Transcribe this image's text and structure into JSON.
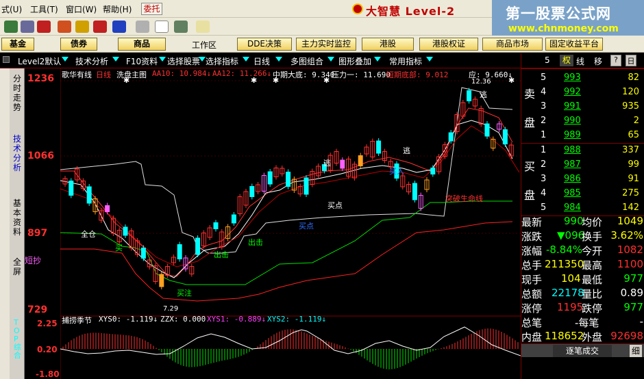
{
  "menu": {
    "items": [
      "式(U)",
      "工具(T)",
      "窗口(W)",
      "帮助(H)"
    ],
    "weituo": "委托",
    "brand": "大智慧 Level-2"
  },
  "watermark": {
    "line1": "第一股票公式网",
    "line2": "www.chnmoney.com"
  },
  "funcbar": {
    "buttons": [
      "基金",
      "债券",
      "商品"
    ],
    "workspace_label": "工作区",
    "modules": [
      "DDE决策",
      "主力实时监控",
      "港股",
      "港股权证",
      "商品市场",
      "固定收益平台"
    ]
  },
  "tabs": {
    "items": [
      "Level2默认",
      "技术分析",
      "F10资料",
      "选择股票",
      "选择指标",
      "日线",
      "多图组合",
      "图形叠加",
      "常用指标"
    ]
  },
  "lefttabs": [
    {
      "label": "分时走势"
    },
    {
      "label": "技术分析"
    },
    {
      "label": "基本资料"
    },
    {
      "label": "全屏"
    }
  ],
  "right_header": {
    "stock_code": "5",
    "buttons": [
      "权",
      "线",
      "移",
      "?",
      "日"
    ]
  },
  "colors": {
    "up": "#ff3030",
    "down": "#00ffff",
    "accent": "#ffff00"
  },
  "main_chart": {
    "header_name": "歌华有线",
    "header_period": "日线",
    "header_formula": "洗盘主图",
    "header_aa10": "AA10: 10.984↓",
    "header_aa12": "AA12: 11.266↓",
    "header_mid": "中期大底: 9.340",
    "header_resist": "压力一: 11.690",
    "header_bottom": "短期底部: 9.012",
    "header_ying": "应: 9.660↓",
    "y_labels": [
      "1236",
      "1066",
      "897",
      "729"
    ],
    "high_label": "12.36",
    "low_label": "7.29",
    "annotations": [
      "全仓",
      "买",
      "买注",
      "出击",
      "出击",
      "买点",
      "买点",
      "逃",
      "逃",
      "逃",
      "买入",
      "突破生命线",
      "短抄"
    ]
  },
  "sub_chart": {
    "header_name": "捕捞季节",
    "header_xys0": "XYS0: -1.119↓",
    "header_zzx": "ZZX: 0.000",
    "header_xys1": "XYS1: -0.889↓",
    "header_xys2": "XYS2: -1.119↓",
    "y_labels": [
      "2.25",
      "0.20",
      "-1.80"
    ],
    "side_label": "TOP综合"
  },
  "orderbook": {
    "sell_label": [
      "卖",
      "盘"
    ],
    "buy_label": [
      "买",
      "盘"
    ],
    "asks": [
      {
        "level": "5",
        "price": "993",
        "volume": "82"
      },
      {
        "level": "4",
        "price": "992",
        "volume": "120"
      },
      {
        "level": "3",
        "price": "991",
        "volume": "935"
      },
      {
        "level": "2",
        "price": "990",
        "volume": "2"
      },
      {
        "level": "1",
        "price": "989",
        "volume": "65"
      }
    ],
    "bids": [
      {
        "level": "1",
        "price": "988",
        "volume": "337"
      },
      {
        "level": "2",
        "price": "987",
        "volume": "99"
      },
      {
        "level": "3",
        "price": "986",
        "volume": "91"
      },
      {
        "level": "4",
        "price": "985",
        "volume": "275"
      },
      {
        "level": "5",
        "price": "984",
        "volume": "142"
      }
    ]
  },
  "stats": [
    {
      "l1": "最新",
      "v1": "990",
      "l2": "均价",
      "v2": "1049"
    },
    {
      "l1": "涨跌",
      "v1": "▼096",
      "l2": "换手",
      "v2": "3.62%"
    },
    {
      "l1": "涨幅",
      "v1": "-8.84%",
      "l2": "今开",
      "v2": "1082"
    },
    {
      "l1": "总手",
      "v1": "211350",
      "l2": "最高",
      "v2": "1100"
    },
    {
      "l1": "现手",
      "v1": "104",
      "l2": "最低",
      "v2": "977"
    },
    {
      "l1": "总额",
      "v1": "22178",
      "l2": "量比",
      "v2": "0.89"
    },
    {
      "l1": "涨停",
      "v1": "1195",
      "l2": "跌停",
      "v2": "977"
    },
    {
      "l1": "总笔",
      "v1": "",
      "l2": "-每笔",
      "v2": "-"
    },
    {
      "l1": "内盘",
      "v1": "118652",
      "l2": "外盘",
      "v2": "92698"
    }
  ],
  "bottom_tabs": {
    "left": "逐笔成交",
    "right": "细"
  }
}
